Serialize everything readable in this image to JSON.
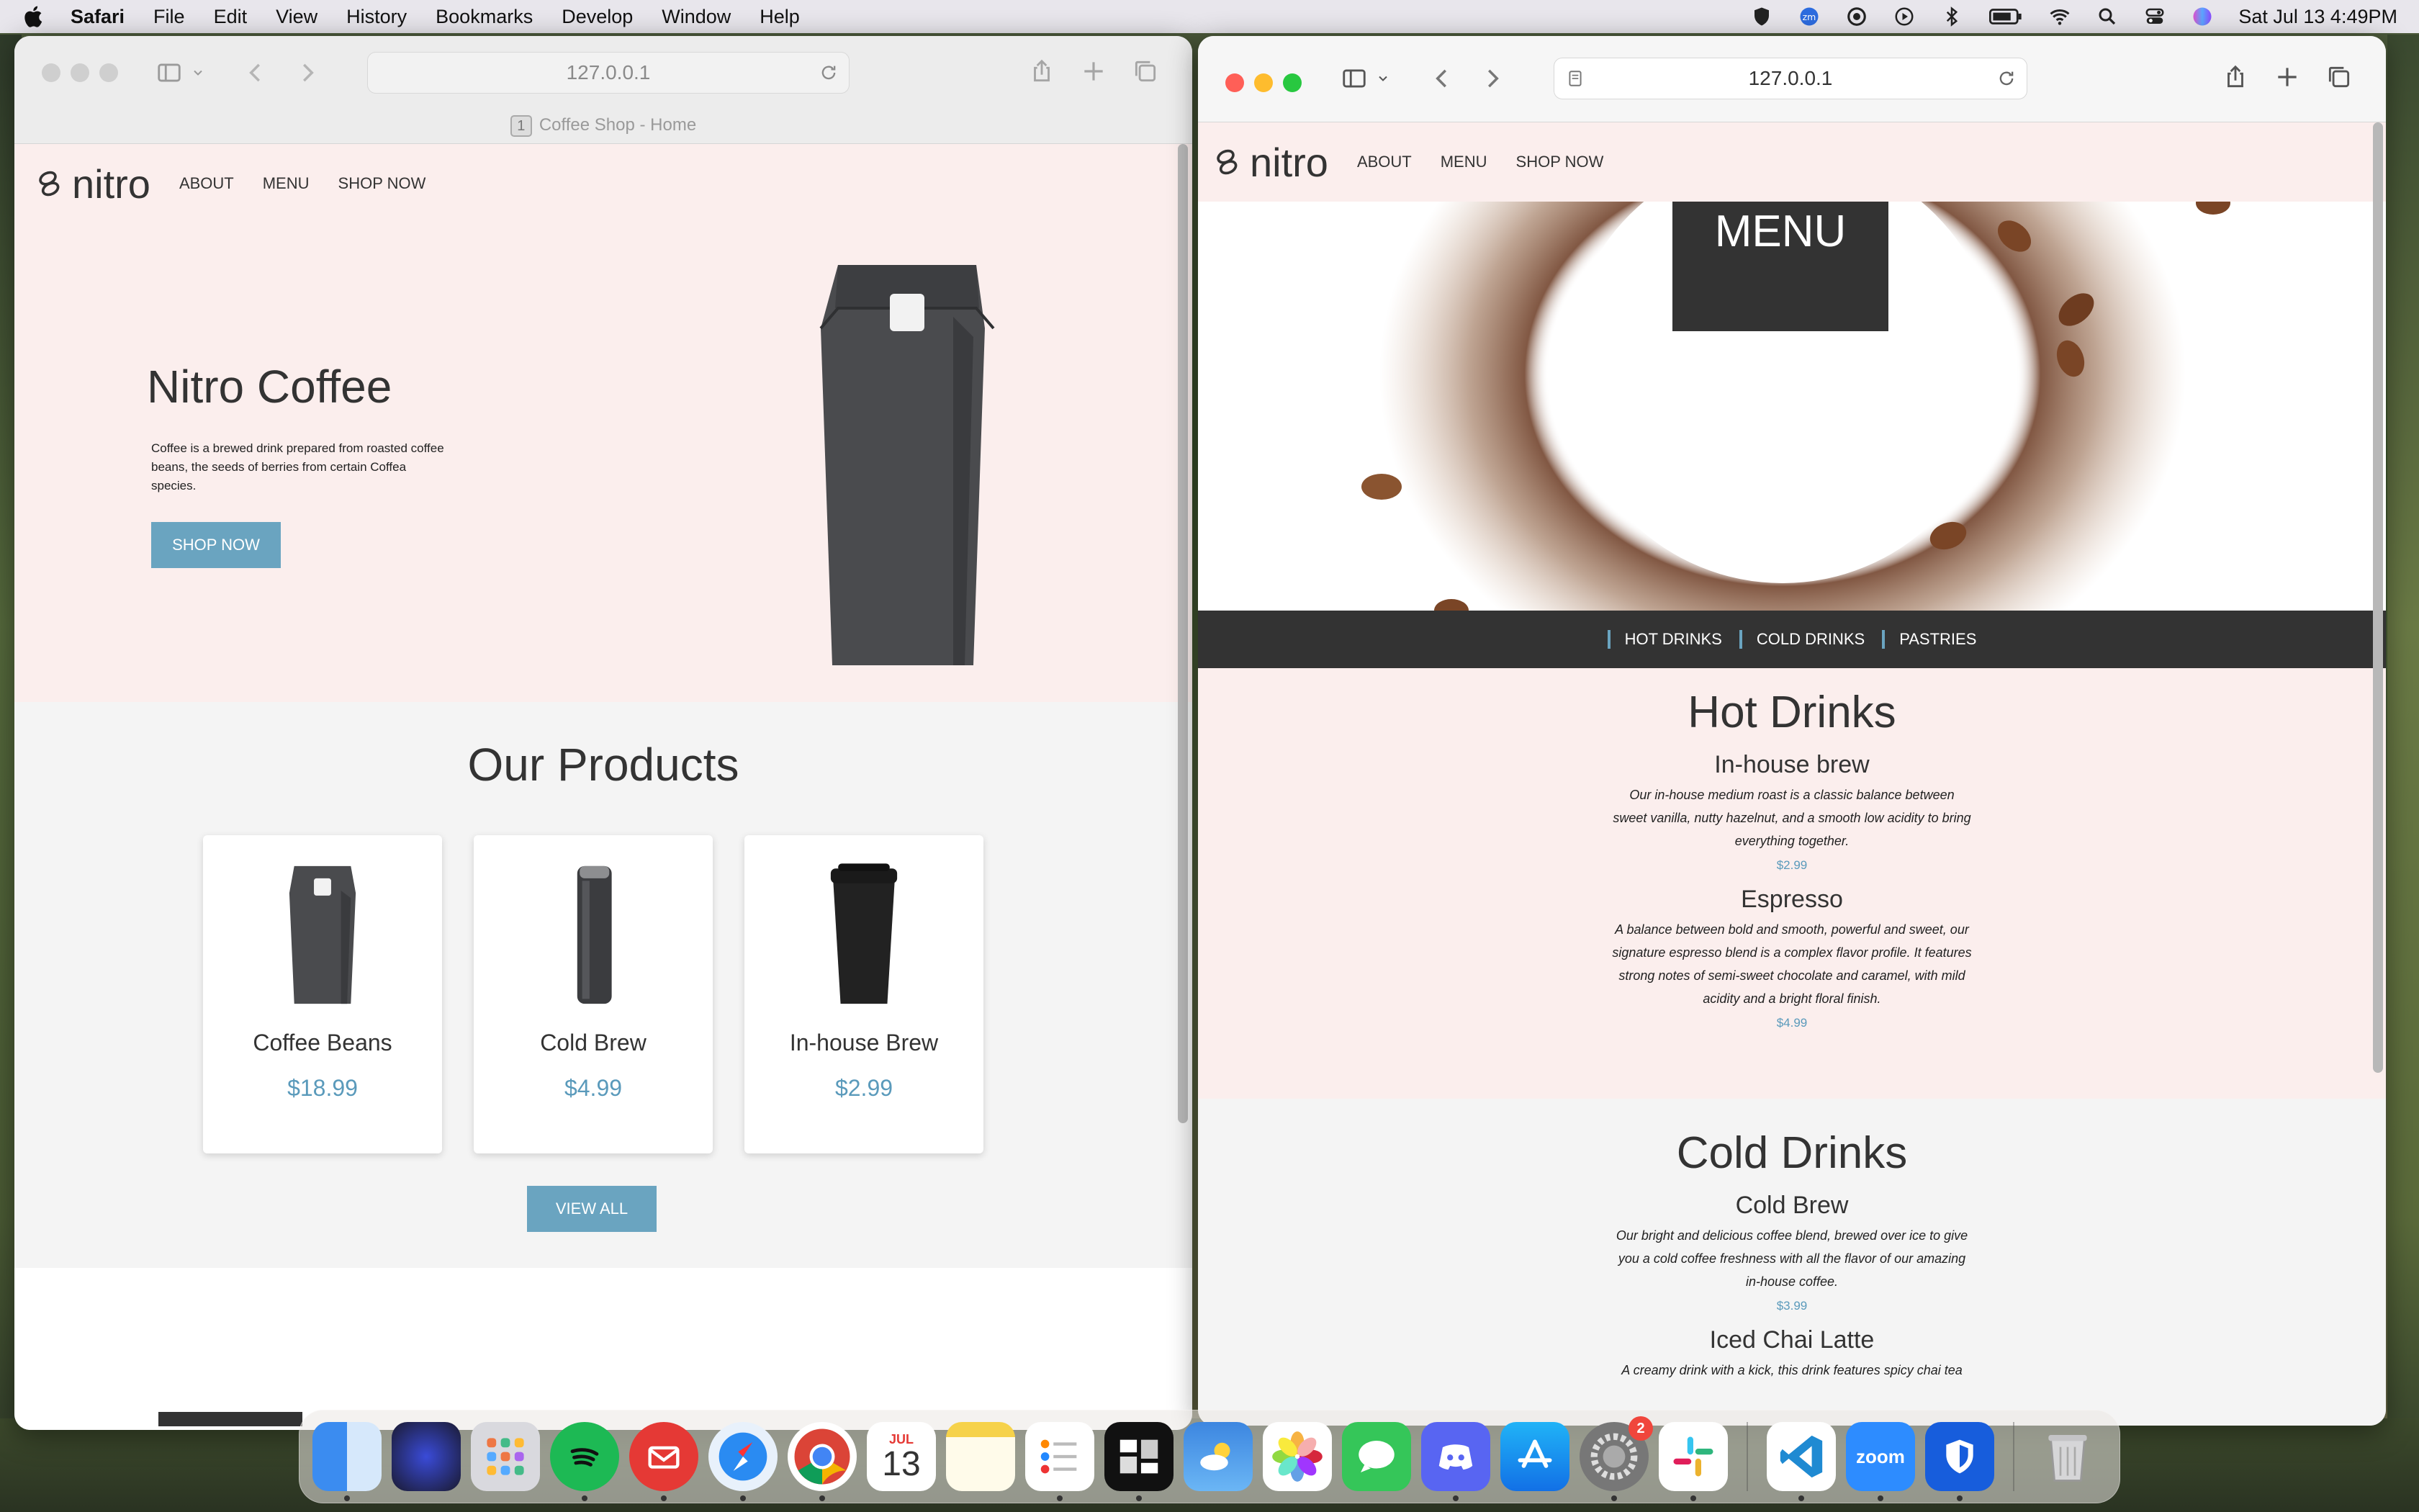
{
  "menubar": {
    "app_name": "Safari",
    "items": [
      "File",
      "Edit",
      "View",
      "History",
      "Bookmarks",
      "Develop",
      "Window",
      "Help"
    ],
    "clock": "Sat Jul 13  4:49PM"
  },
  "left_window": {
    "url": "127.0.0.1",
    "tab_number": "1",
    "tab_title": "Coffee Shop - Home",
    "site": {
      "logo": "nitro",
      "nav": [
        "ABOUT",
        "MENU",
        "SHOP NOW"
      ],
      "hero_title": "Nitro Coffee",
      "hero_text": "Coffee is a brewed drink prepared from roasted coffee beans, the seeds of berries from certain Coffea species.",
      "hero_button": "SHOP NOW",
      "products_title": "Our Products",
      "products": [
        {
          "name": "Coffee Beans",
          "price": "$18.99"
        },
        {
          "name": "Cold Brew",
          "price": "$4.99"
        },
        {
          "name": "In-house Brew",
          "price": "$2.99"
        }
      ],
      "view_all": "VIEW ALL"
    }
  },
  "right_window": {
    "url": "127.0.0.1",
    "site": {
      "logo": "nitro",
      "nav": [
        "ABOUT",
        "MENU",
        "SHOP NOW"
      ],
      "banner_title": "MENU",
      "categories": [
        "HOT DRINKS",
        "COLD DRINKS",
        "PASTRIES"
      ],
      "hot": {
        "title": "Hot Drinks",
        "items": [
          {
            "name": "In-house brew",
            "desc": "Our in-house medium roast is a classic balance between sweet vanilla, nutty hazelnut, and a smooth low acidity to bring everything together.",
            "price": "$2.99"
          },
          {
            "name": "Espresso",
            "desc": "A balance between bold and smooth, powerful and sweet, our signature espresso blend is a complex flavor profile. It features strong notes of semi-sweet chocolate and caramel, with mild acidity and a bright floral finish.",
            "price": "$4.99"
          }
        ]
      },
      "cold": {
        "title": "Cold Drinks",
        "items": [
          {
            "name": "Cold Brew",
            "desc": "Our bright and delicious coffee blend, brewed over ice to give you a cold coffee freshness with all the flavor of our amazing in-house coffee.",
            "price": "$3.99"
          },
          {
            "name": "Iced Chai Latte",
            "desc": "A creamy drink with a kick, this drink features spicy chai tea",
            "price": ""
          }
        ]
      }
    }
  },
  "dock": {
    "calendar_month": "JUL",
    "calendar_day": "13",
    "zoom_label": "zoom",
    "settings_badge": "2",
    "apps": [
      "finder-icon",
      "siri-icon",
      "launchpad-icon",
      "spotify-icon",
      "mail-icon",
      "safari-icon",
      "chrome-icon",
      "calendar-icon",
      "notes-icon",
      "reminders-icon",
      "screens-icon",
      "weather-icon",
      "photos-icon",
      "messages-icon",
      "discord-icon",
      "app-store-icon",
      "system-settings-icon",
      "slack-icon",
      "vscode-icon",
      "zoom-icon",
      "bitwarden-icon",
      "trash-icon"
    ]
  }
}
